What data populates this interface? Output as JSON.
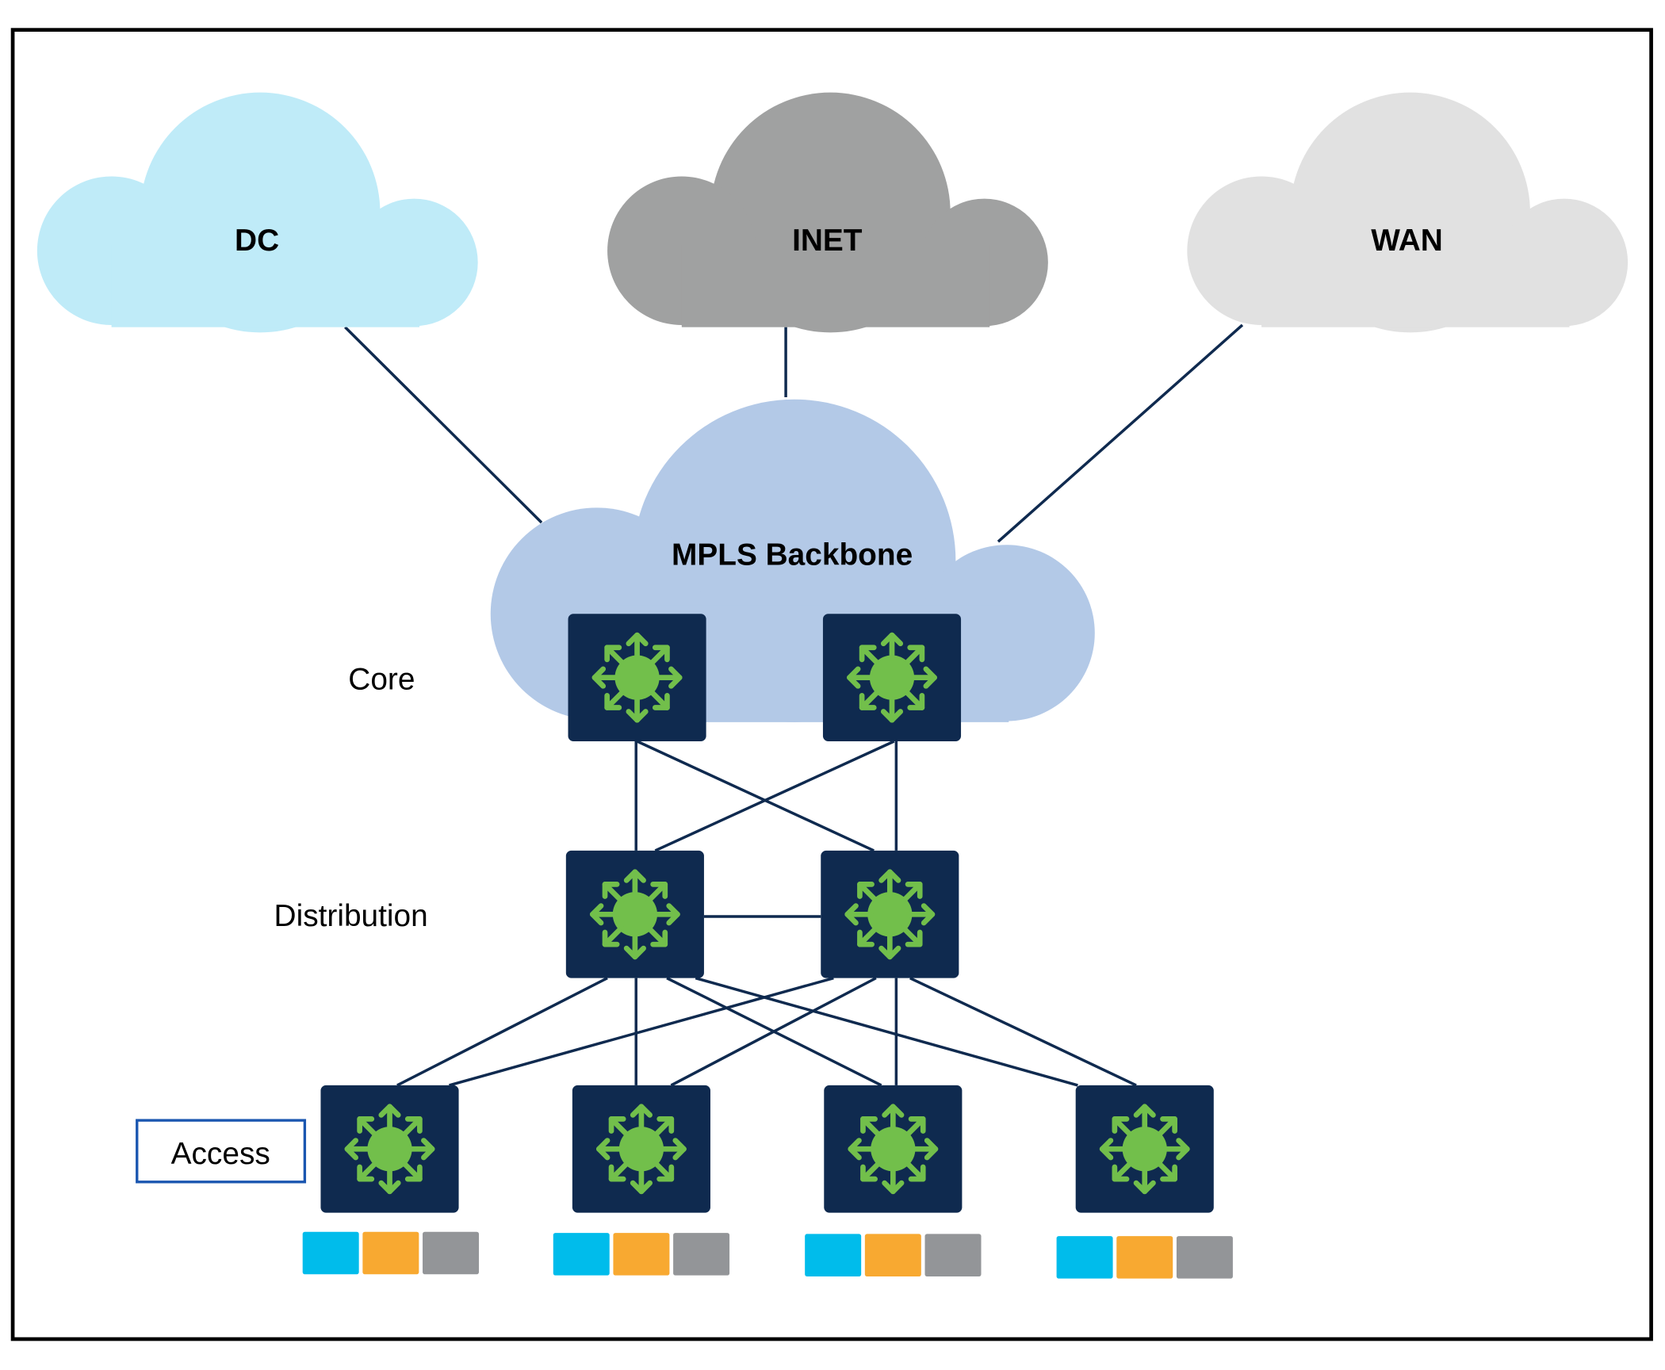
{
  "clouds": {
    "dc": {
      "label": "DC",
      "color": "#bfebf8"
    },
    "inet": {
      "label": "INET",
      "color": "#a0a1a1"
    },
    "wan": {
      "label": "WAN",
      "color": "#e1e1e1"
    },
    "mpls": {
      "label": "MPLS Backbone",
      "color": "#b3c9e7"
    }
  },
  "tiers": {
    "core": "Core",
    "distribution": "Distribution",
    "access": "Access"
  },
  "colors": {
    "switch_bg": "#0f2a4f",
    "switch_icon": "#72bf4b",
    "link": "#0f2a4f",
    "access_box_border": "#1a56b0",
    "endpoint_colors": [
      "#00bceb",
      "#f8a931",
      "#939598"
    ]
  },
  "icons": {
    "switch": "multilayer-switch-icon"
  }
}
